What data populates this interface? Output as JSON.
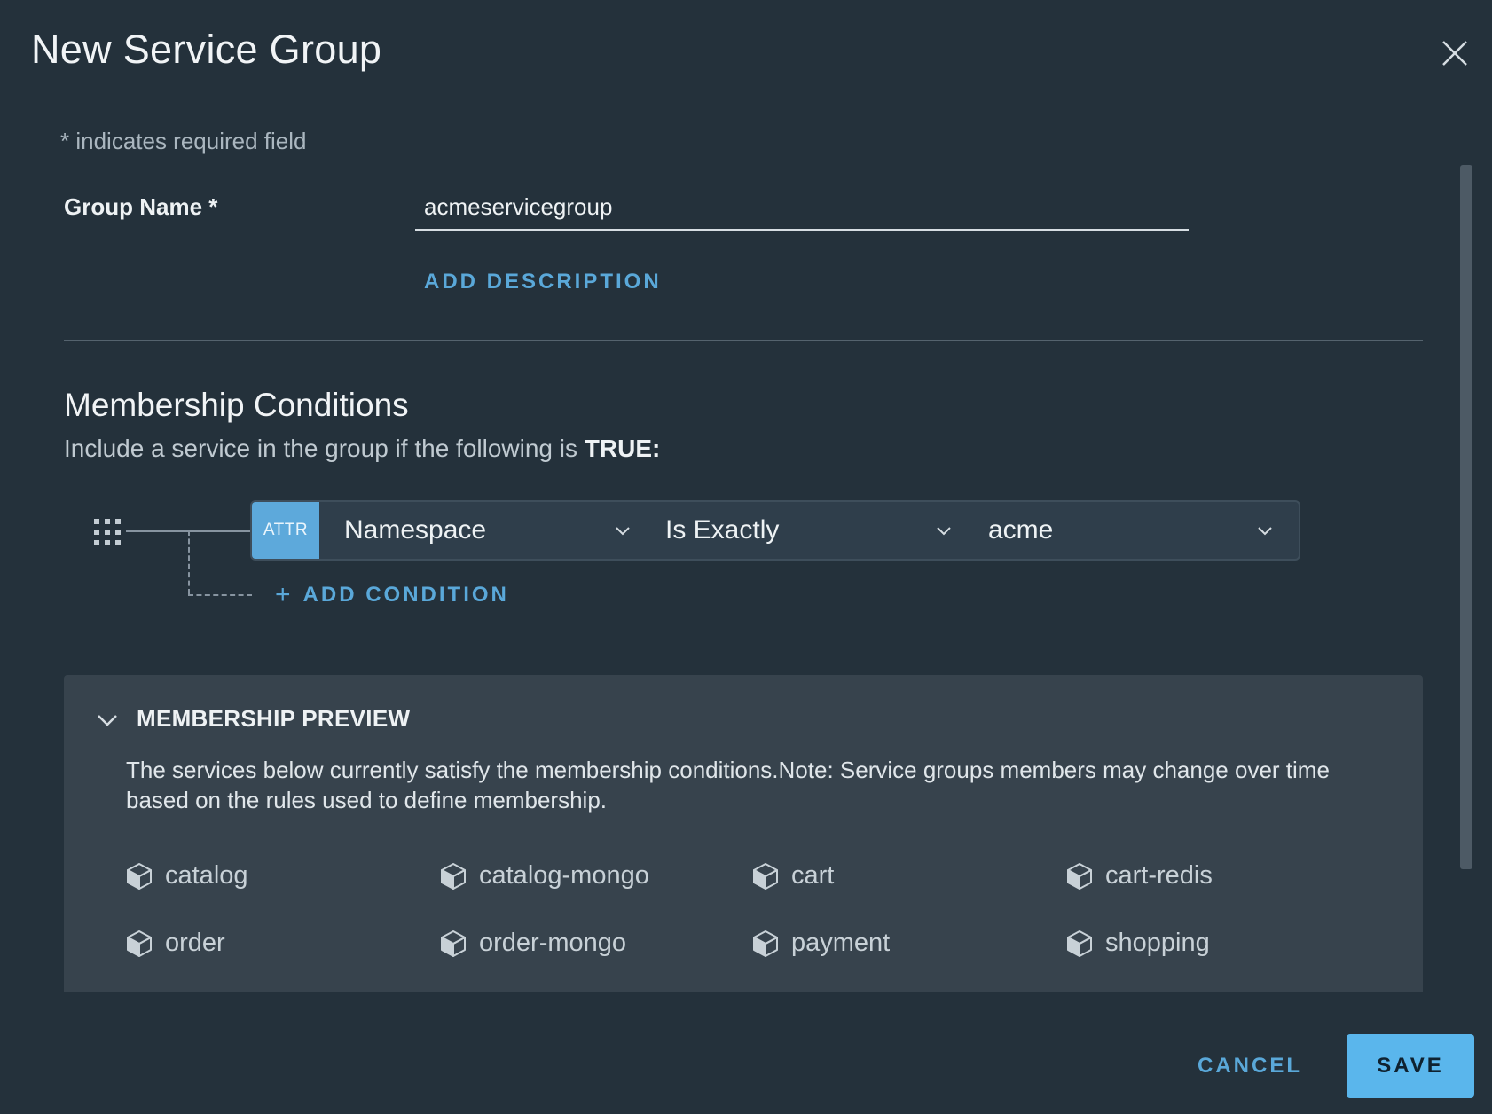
{
  "dialog": {
    "title": "New Service Group",
    "required_note": "* indicates required field"
  },
  "form": {
    "group_name_label": "Group Name *",
    "group_name_value": "acmeservicegroup",
    "add_description_label": "ADD DESCRIPTION"
  },
  "membership": {
    "title": "Membership Conditions",
    "subtitle_prefix": "Include a service in the group if the following is ",
    "subtitle_bold": "TRUE:",
    "condition": {
      "badge": "ATTR",
      "attribute": "Namespace",
      "operator": "Is Exactly",
      "value": "acme"
    },
    "add_condition_label": "ADD CONDITION"
  },
  "preview": {
    "title": "MEMBERSHIP PREVIEW",
    "description": "The services below currently satisfy the membership conditions.Note: Service groups members may change over time based on the rules used to define membership.",
    "services": [
      "catalog",
      "catalog-mongo",
      "cart",
      "cart-redis",
      "order",
      "order-mongo",
      "payment",
      "shopping"
    ]
  },
  "footer": {
    "cancel_label": "CANCEL",
    "save_label": "SAVE"
  },
  "colors": {
    "background": "#24313b",
    "accent": "#5aa8d9",
    "save_button": "#5ab6ec",
    "preview_panel": "#37434d"
  }
}
